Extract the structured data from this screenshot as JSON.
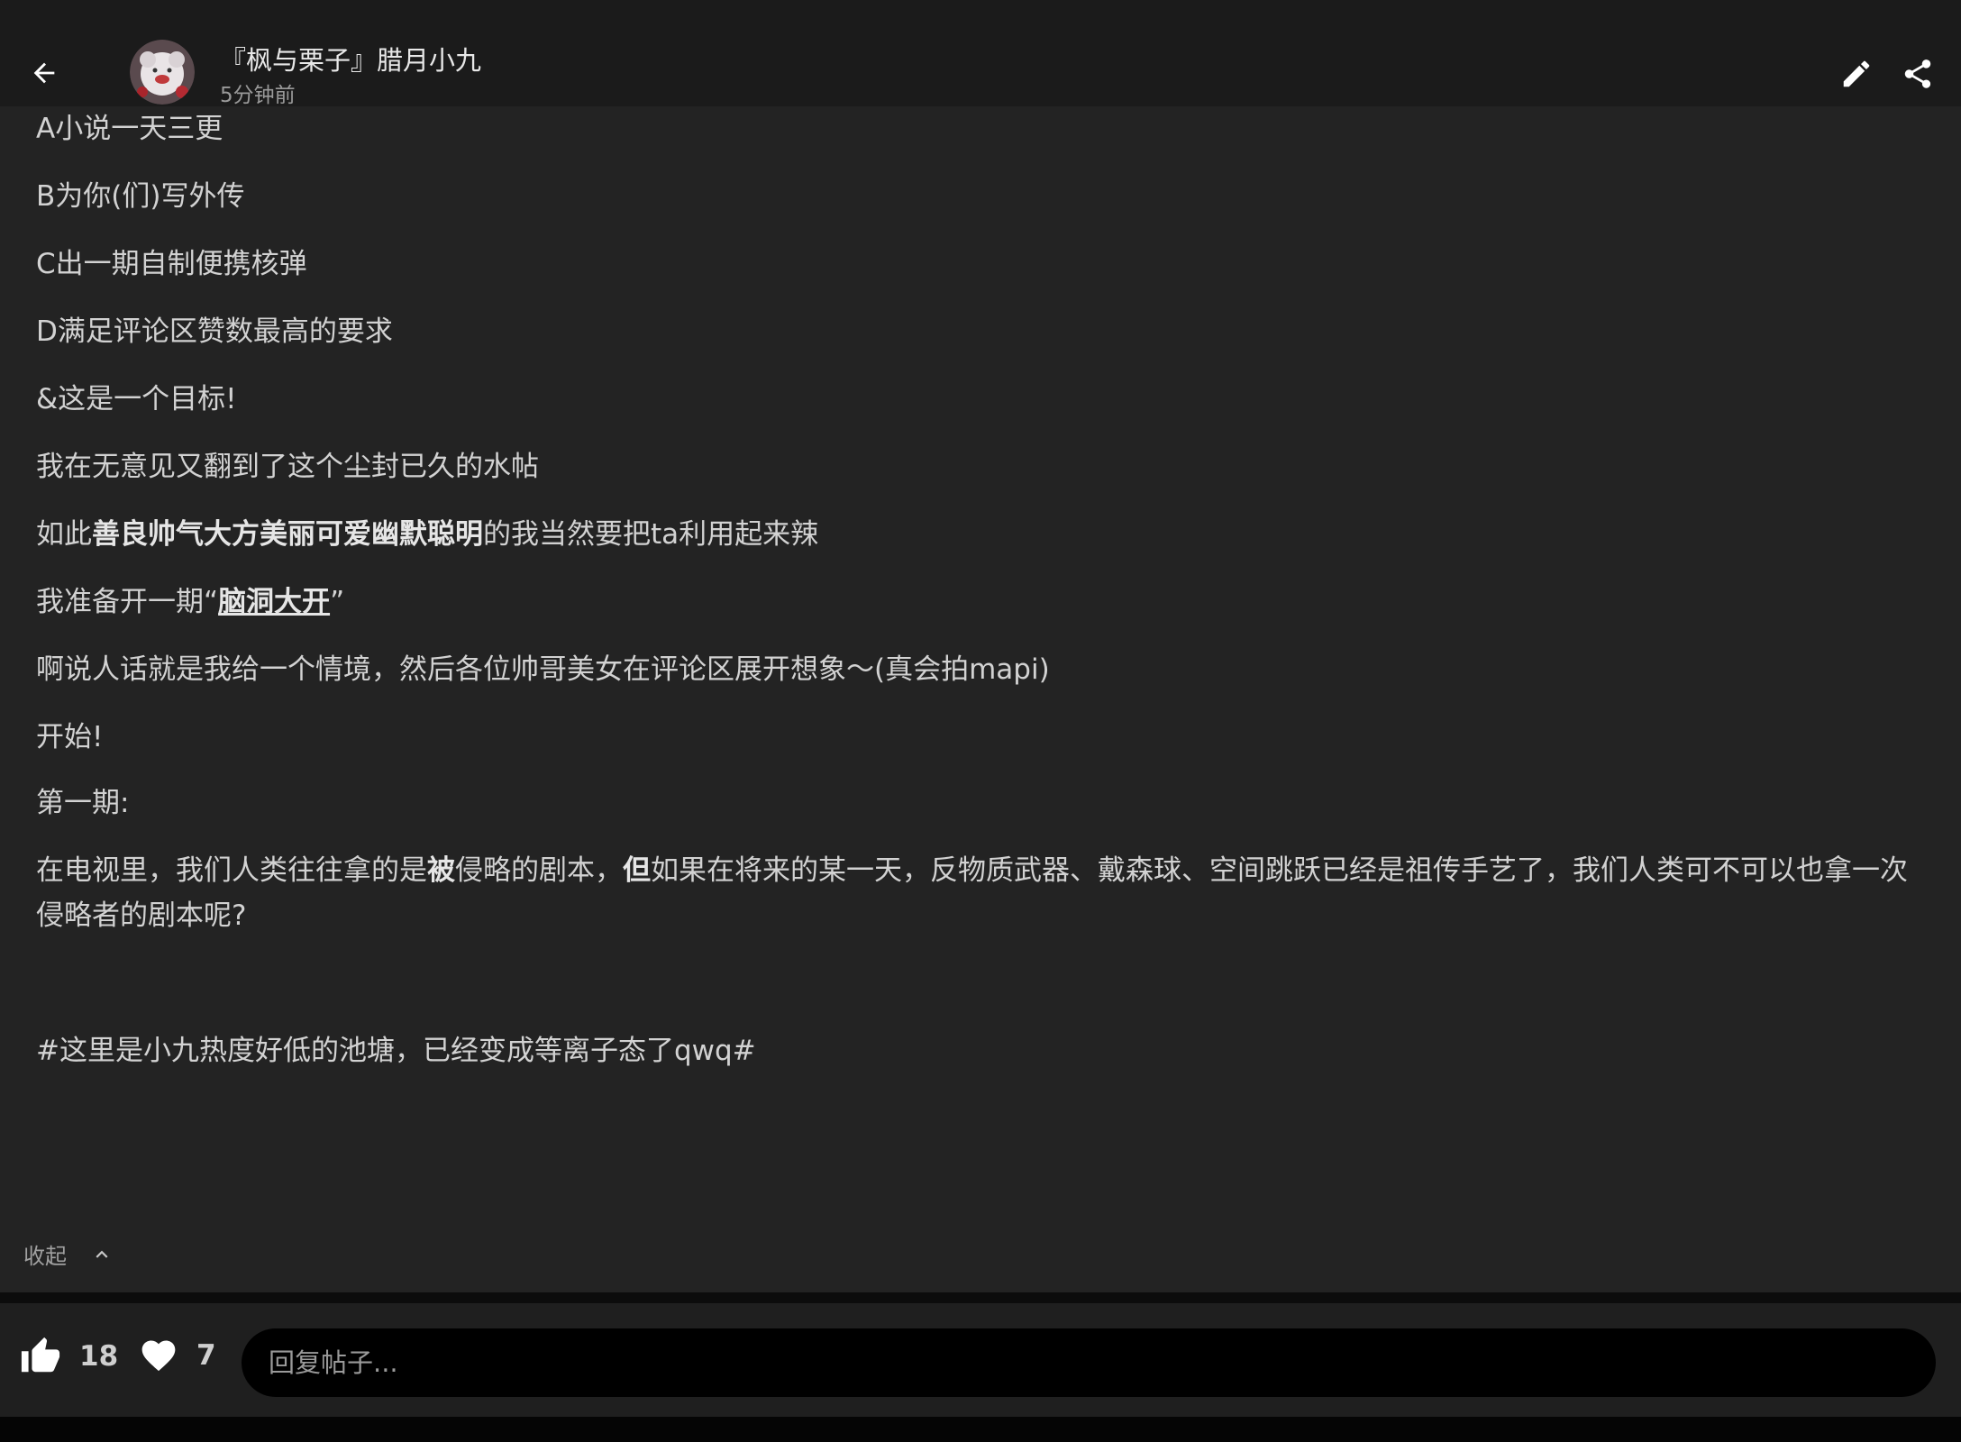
{
  "header": {
    "author_name": "『枫与栗子』腊月小九",
    "post_time": "5分钟前"
  },
  "post": {
    "lines": [
      {
        "id": "l1",
        "parts": [
          {
            "t": "A小说一天三更"
          }
        ]
      },
      {
        "id": "l2",
        "parts": [
          {
            "t": "B为你(们)写外传"
          }
        ]
      },
      {
        "id": "l3",
        "parts": [
          {
            "t": " C出一期自制便携核弹"
          }
        ]
      },
      {
        "id": "l4",
        "parts": [
          {
            "t": "D满足评论区赞数最高的要求"
          }
        ]
      },
      {
        "id": "l5",
        "parts": [
          {
            "t": "&这是一个目标!"
          }
        ]
      },
      {
        "id": "l6",
        "parts": [
          {
            "t": "我在无意见又翻到了这个尘封已久的水帖"
          }
        ]
      },
      {
        "id": "l7",
        "parts": [
          {
            "t": "如此"
          },
          {
            "t": "善良帅气大方美丽可爱幽默聪明",
            "b": true
          },
          {
            "t": "的我当然要把ta利用起来辣"
          }
        ]
      },
      {
        "id": "l8",
        "parts": [
          {
            "t": "我准备开一期“"
          },
          {
            "t": "脑洞大开",
            "u": true
          },
          {
            "t": "”"
          }
        ]
      },
      {
        "id": "l9",
        "parts": [
          {
            "t": "啊说人话就是我给一个情境，然后各位帅哥美女在评论区展开想象～(真会拍mapi)"
          }
        ]
      },
      {
        "id": "l10",
        "parts": [
          {
            "t": "开始!"
          }
        ]
      },
      {
        "id": "l11",
        "parts": [
          {
            "t": "第一期:"
          }
        ]
      },
      {
        "id": "l12",
        "parts": [
          {
            "t": "在电视里，我们人类往往拿的是"
          },
          {
            "t": "被",
            "b": true
          },
          {
            "t": "侵略的剧本，"
          },
          {
            "t": "但",
            "b": true
          },
          {
            "t": "如果在将来的某一天，反物质武器、戴森球、空间跳跃已经是祖传手艺了，我们人类可不可以也拿一次侵略者的剧本呢?"
          }
        ]
      },
      {
        "id": "l13",
        "parts": [
          {
            "t": "#这里是小九热度好低的池塘，已经变成等离子态了qwq#"
          }
        ]
      }
    ]
  },
  "collapse_label": "收起",
  "actions": {
    "like_count": "18",
    "favorite_count": "7",
    "reply_placeholder": "回复帖子..."
  },
  "colors": {
    "background": "#232323",
    "header_bg": "#1b1b1b",
    "text": "#d2d2d2",
    "reply_box_bg": "#000000"
  },
  "icons": [
    "back-arrow-icon",
    "avatar",
    "edit-pencil-icon",
    "share-icon",
    "chevron-up-icon",
    "thumbs-up-icon",
    "heart-icon"
  ]
}
